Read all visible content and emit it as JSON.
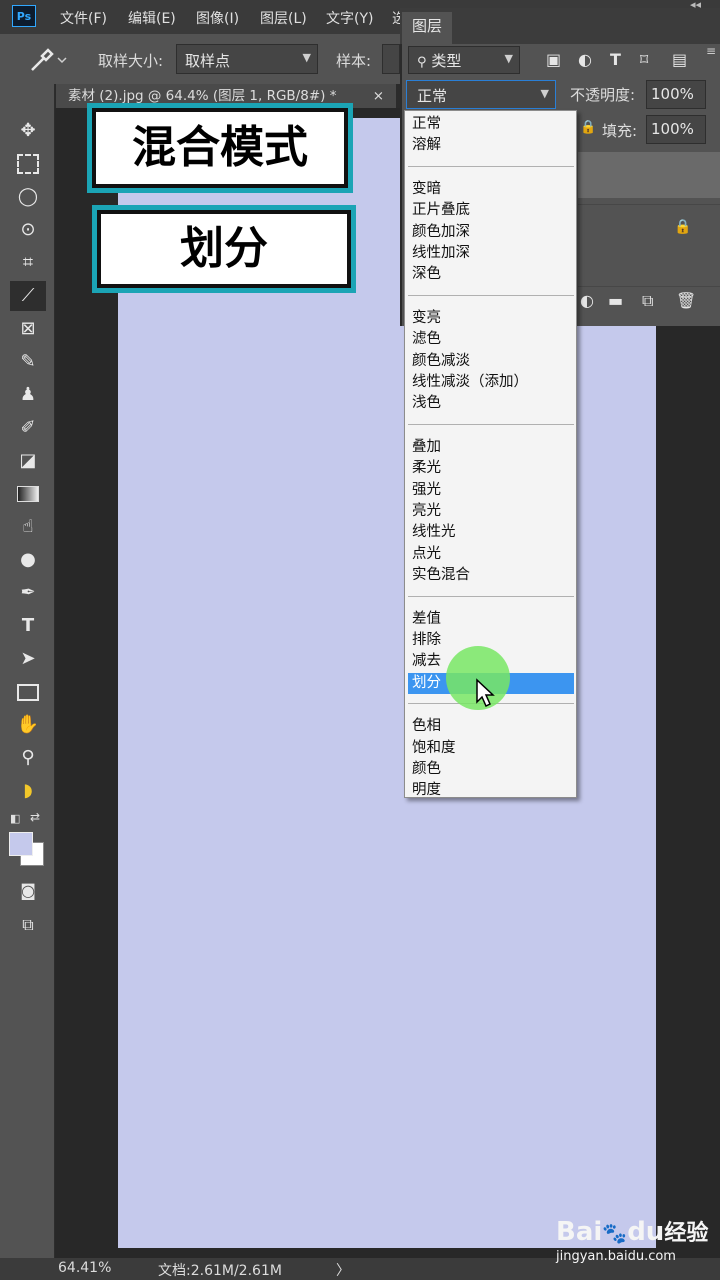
{
  "app": {
    "logo": "Ps"
  },
  "menu": [
    "文件(F)",
    "编辑(E)",
    "图像(I)",
    "图层(L)",
    "文字(Y)",
    "选"
  ],
  "options": {
    "sample_size_label": "取样大小:",
    "sample_size_value": "取样点",
    "sample_label": "样本:"
  },
  "document_tab": {
    "title": "素材 (2).jpg @ 64.4% (图层 1, RGB/8#) *",
    "close": "×"
  },
  "title_cards": {
    "line1": "混合模式",
    "line2": "划分"
  },
  "layers_panel": {
    "title": "图层",
    "filter_label": "类型",
    "blend_mode": "正常",
    "opacity_label": "不透明度:",
    "opacity_value": "100%",
    "fill_label": "填充:",
    "fill_value": "100%"
  },
  "blend_menu": {
    "groups": [
      [
        "正常",
        "溶解"
      ],
      [
        "变暗",
        "正片叠底",
        "颜色加深",
        "线性加深",
        "深色"
      ],
      [
        "变亮",
        "滤色",
        "颜色减淡",
        "线性减淡（添加）",
        "浅色"
      ],
      [
        "叠加",
        "柔光",
        "强光",
        "亮光",
        "线性光",
        "点光",
        "实色混合"
      ],
      [
        "差值",
        "排除",
        "减去",
        "划分"
      ],
      [
        "色相",
        "饱和度",
        "颜色",
        "明度"
      ]
    ],
    "selected": "划分"
  },
  "status": {
    "zoom": "64.41%",
    "doc_info": "文档:2.61M/2.61M",
    "arrow": "〉"
  },
  "watermark": {
    "brand": "Bai",
    "paw": "du",
    "cn": "经验",
    "url": "jingyan.baidu.com"
  },
  "colors": {
    "canvas": "#c5c9ec",
    "accent_frame": "#1ba4b5",
    "selection": "#3c95f0",
    "cursor_halo": "#78e664"
  },
  "icons": [
    "move-icon",
    "marquee-icon",
    "lasso-icon",
    "quick-select-icon",
    "crop-icon",
    "eyedropper-icon",
    "frame-icon",
    "brush-icon",
    "stamp-icon",
    "history-brush-icon",
    "eraser-icon",
    "gradient-icon",
    "smudge-icon",
    "dodge-icon",
    "pen-icon",
    "type-icon",
    "path-select-icon",
    "rectangle-icon",
    "hand-icon",
    "zoom-icon",
    "banana-icon"
  ]
}
